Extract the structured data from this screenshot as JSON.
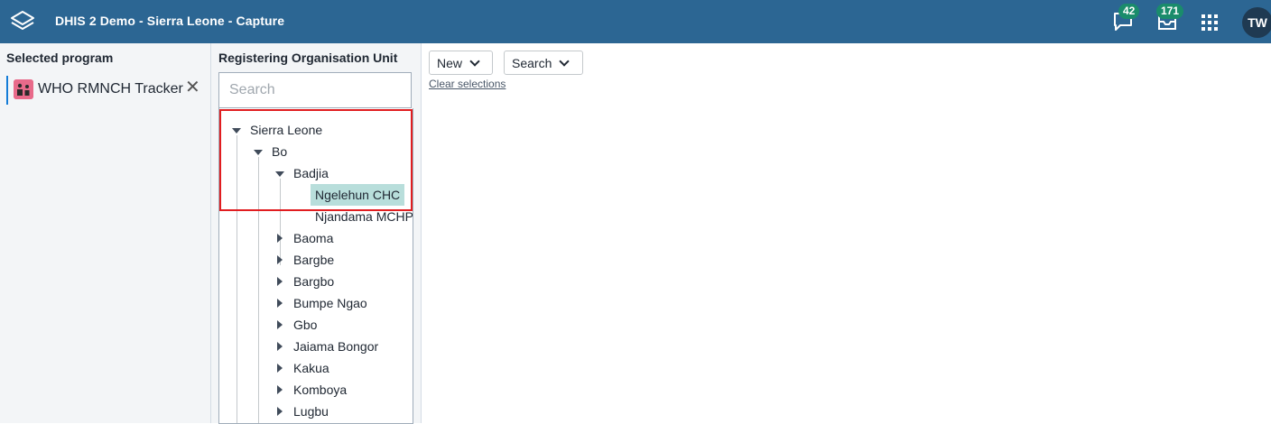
{
  "header": {
    "app_title": "DHIS 2 Demo - Sierra Leone - Capture",
    "messages_count": "42",
    "interpretations_count": "171",
    "user_initials": "TW",
    "colors": {
      "bar": "#2c6693",
      "badge": "#1a8c6b"
    },
    "icons": [
      "dhis2-logo-icon",
      "message-icon",
      "inbox-icon",
      "apps-grid-icon"
    ]
  },
  "left_panel": {
    "heading": "Selected program",
    "program_name": "WHO RMNCH Tracker",
    "clear_symbol": "✕"
  },
  "ou_panel": {
    "heading": "Registering Organisation Unit",
    "search_placeholder": "Search",
    "tree": {
      "root": "Sierra Leone",
      "district": "Bo",
      "chiefdom": "Badjia",
      "facility_selected": "Ngelehun CHC",
      "facility_other": "Njandama MCHP",
      "other_chiefdoms": [
        "Baoma",
        "Bargbe",
        "Bargbo",
        "Bumpe Ngao",
        "Gbo",
        "Jaiama Bongor",
        "Kakua",
        "Komboya",
        "Lugbu"
      ]
    }
  },
  "main": {
    "new_label": "New",
    "search_label": "Search",
    "clear_selections": "Clear selections"
  }
}
